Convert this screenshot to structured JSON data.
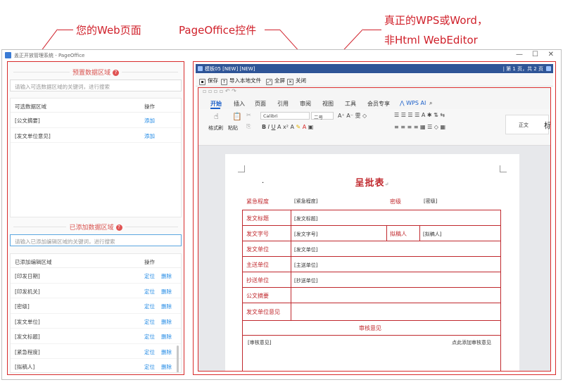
{
  "annotations": {
    "web_page": "您的Web页面",
    "pageoffice_control": "PageOffice控件",
    "real_wps_line1": "真正的WPS或Word，",
    "real_wps_line2": "非Html WebEditor"
  },
  "colors": {
    "accent_red": "#d82b2b",
    "link_blue": "#1e88e5",
    "title_bar": "#2f5597"
  },
  "window": {
    "title": "盖正开放管理系统 - PageOffice",
    "controls": [
      "—",
      "☐",
      "✕"
    ]
  },
  "left_panel": {
    "preset_section_title": "预置数据区域",
    "preset_search_placeholder": "请输入可选数据区域的关键词，进行搜索",
    "preset_table": {
      "col_name": "可选数据区域",
      "col_action": "操作",
      "rows": [
        {
          "name": "[公文摘要]",
          "action": "添加"
        },
        {
          "name": "[发文单位意见]",
          "action": "添加"
        }
      ]
    },
    "added_section_title": "已添加数据区域",
    "added_search_placeholder": "请输入已添加编辑区域的关键词，进行搜索",
    "added_table": {
      "col_name": "已添加编辑区域",
      "col_action": "操作",
      "action_locate": "定位",
      "action_delete": "删除",
      "rows": [
        "[印发日期]",
        "[印发机关]",
        "[密级]",
        "[发文单位]",
        "[发文标题]",
        "[紧急程度]",
        "[拟稿人]"
      ]
    }
  },
  "pageoffice": {
    "title": "模板05 [NEW] [NEW]",
    "page_info": "| 第 1 页，共 2 页",
    "toolbar": [
      "保存",
      "导入本地文件",
      "全屏",
      "关闭"
    ]
  },
  "wps": {
    "tabs": [
      "开始",
      "插入",
      "页面",
      "引用",
      "审阅",
      "视图",
      "工具",
      "会员专享"
    ],
    "wps_ai": "WPS AI",
    "font_name": "Calibri",
    "font_size": "二号",
    "format_painter": "格式刷",
    "paste": "粘贴",
    "style_normal": "正文"
  },
  "document": {
    "title": "呈批表",
    "para_mark": "↵",
    "urgency_label": "紧急程度",
    "urgency_value": "[紧急程度]",
    "secret_label": "密级",
    "secret_value": "[密级]",
    "rows": [
      {
        "label": "发文标题",
        "value": "[发文标题]"
      },
      {
        "label": "发文字号",
        "value": "[发文字号]",
        "label2": "拟稿人",
        "value2": "[拟稿人]"
      },
      {
        "label": "发文单位",
        "value": "[发文单位]"
      },
      {
        "label": "主送单位",
        "value": "[主送单位]"
      },
      {
        "label": "抄送单位",
        "value": "[抄送单位]"
      },
      {
        "label": "公文摘要",
        "value": ""
      },
      {
        "label": "发文单位意见",
        "value": ""
      }
    ],
    "review_title": "审核意见",
    "review_value": "[审核意见]",
    "review_hint": "点此添加审核意见"
  }
}
